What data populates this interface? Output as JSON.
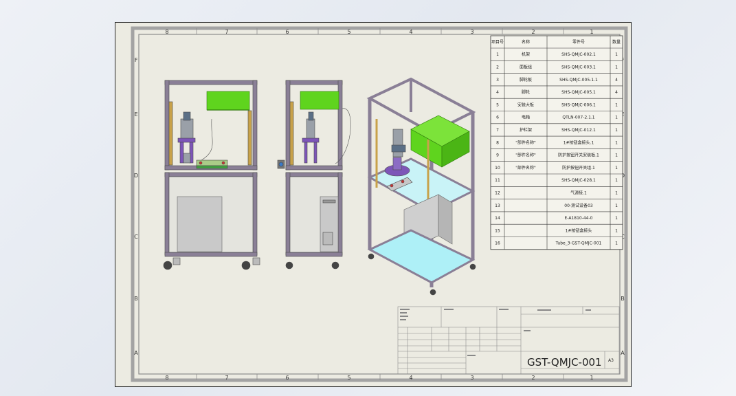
{
  "sheet": {
    "zones_top": [
      "8",
      "7",
      "6",
      "5",
      "4",
      "3",
      "2",
      "1"
    ],
    "zones_bottom": [
      "8",
      "7",
      "6",
      "5",
      "4",
      "3",
      "2",
      "1"
    ],
    "zones_side": [
      "F",
      "E",
      "D",
      "C",
      "B",
      "A"
    ]
  },
  "bom": {
    "headers": [
      "项目号",
      "名称",
      "零件号",
      "数量"
    ],
    "rows": [
      {
        "no": "1",
        "name": "机架",
        "part": "SHS-QMJC-002.1",
        "qty": "1"
      },
      {
        "no": "2",
        "name": "面板组",
        "part": "SHS-QMJC-003.1",
        "qty": "1"
      },
      {
        "no": "3",
        "name": "脚轮板",
        "part": "SHS-QMJC-005-1.1",
        "qty": "4"
      },
      {
        "no": "4",
        "name": "脚轮",
        "part": "SHS-QMJC-005.1",
        "qty": "4"
      },
      {
        "no": "5",
        "name": "安装大板",
        "part": "SHS-QMJC-006.1",
        "qty": "1"
      },
      {
        "no": "6",
        "name": "电箱",
        "part": "QTLN-007-2.1.1",
        "qty": "1"
      },
      {
        "no": "7",
        "name": "护栏架",
        "part": "SHS-QMJC-012.1",
        "qty": "1"
      },
      {
        "no": "8",
        "name": "\"部件名称\"",
        "part": "1#按钮盒接头.1",
        "qty": "1"
      },
      {
        "no": "9",
        "name": "\"部件名称\"",
        "part": "防护按钮开关安装板.1",
        "qty": "1"
      },
      {
        "no": "10",
        "name": "\"部件名称\"",
        "part": "防护按钮开关组.1",
        "qty": "1"
      },
      {
        "no": "11",
        "name": "",
        "part": "SHS-QMJC-028.1",
        "qty": "1"
      },
      {
        "no": "12",
        "name": "",
        "part": "气源接.1",
        "qty": "1"
      },
      {
        "no": "13",
        "name": "",
        "part": "00-测试设备03",
        "qty": "1"
      },
      {
        "no": "14",
        "name": "",
        "part": "E-A1810-44-0",
        "qty": "1"
      },
      {
        "no": "15",
        "name": "",
        "part": "1#按钮盒接头",
        "qty": "1"
      },
      {
        "no": "16",
        "name": "",
        "part": "Tube_3-GST-QMJC-001",
        "qty": "1"
      }
    ]
  },
  "title_block": {
    "drawing_number": "GST-QMJC-001",
    "sheet_size": "A3"
  },
  "colors": {
    "sheet_bg": "#ecebe2",
    "frame_line": "#9a9a9a",
    "guard_green": "#5fd41e",
    "aluminum_frame": "#8a7f96",
    "glass_cyan": "#c9f3f7",
    "cabinet_grey": "#c9c9c9",
    "fixture_purple": "#7d55b8"
  }
}
